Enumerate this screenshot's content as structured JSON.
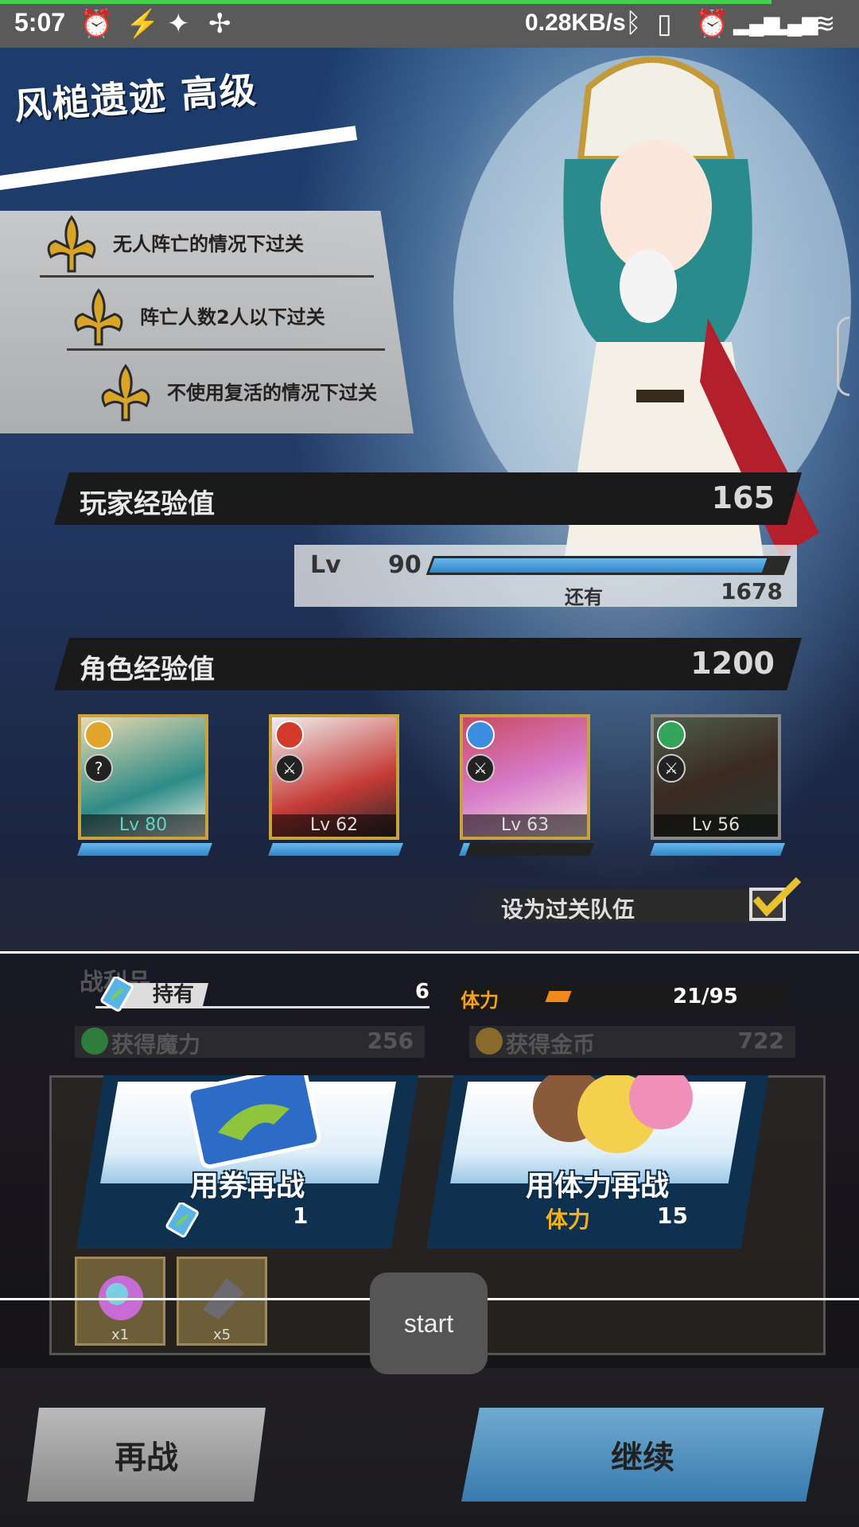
{
  "status_bar": {
    "time": "5:07",
    "net_speed": "0.28KB/s",
    "icons": [
      "alarm-icon",
      "flash-icon",
      "app-icon",
      "pinwheel-icon",
      "bluetooth-icon",
      "vibrate-off-icon",
      "alarm-icon",
      "signal-icon",
      "signal-icon",
      "wifi-icon"
    ]
  },
  "stage": {
    "title": "风槌遗迹  高级"
  },
  "missions": [
    {
      "text": "无人阵亡的情况下过关"
    },
    {
      "text": "阵亡人数2人以下过关"
    },
    {
      "text": "不使用复活的情况下过关"
    }
  ],
  "player_exp": {
    "label": "玩家经验值",
    "value": "165",
    "lv_label": "Lv",
    "level": "90",
    "progress": 0.95,
    "remaining_label": "还有",
    "remaining": "1678"
  },
  "char_exp": {
    "label": "角色经验值",
    "value": "1200"
  },
  "party": [
    {
      "level": "Lv 80",
      "element_color": "#e0a52a",
      "progress": 1.0
    },
    {
      "level": "Lv 62",
      "element_color": "#d23b2a",
      "progress": 1.0
    },
    {
      "level": "Lv 63",
      "element_color": "#3c8de0",
      "progress": 0.05
    },
    {
      "level": "Lv 56",
      "element_color": "#33a55a",
      "progress": 1.0
    }
  ],
  "set_team": {
    "label": "设为过关队伍",
    "checked": true
  },
  "loot": {
    "label": "战利品",
    "held_label": "持有",
    "held": "6",
    "stamina_label": "体力",
    "stamina": "21/95",
    "stamina_fill": 0.22,
    "magic_label": "获得魔力",
    "magic": "256",
    "gold_label": "获得金币",
    "gold": "722",
    "items": [
      {
        "qty": "x1"
      },
      {
        "qty": "x5"
      }
    ]
  },
  "retry_ticket": {
    "label": "用券再战",
    "cost": "1"
  },
  "retry_stamina": {
    "label": "用体力再战",
    "cost_label": "体力",
    "cost": "15"
  },
  "toast": {
    "text": "start"
  },
  "buttons": {
    "retry": "再战",
    "continue": "继续"
  },
  "colors": {
    "accent_blue": "#2f86c9",
    "gold": "#f4a21a",
    "frame": "#0e3150"
  }
}
